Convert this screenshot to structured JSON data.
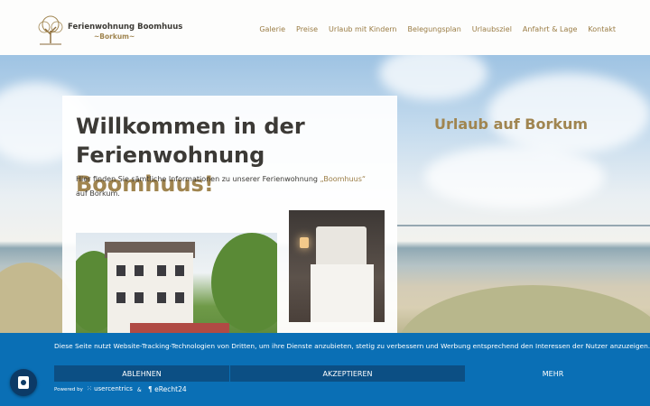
{
  "header": {
    "logo_title": "Ferienwohnung Boomhuus",
    "logo_sub": "~Borkum~",
    "nav": [
      "Galerie",
      "Preise",
      "Urlaub mit Kindern",
      "Belegungsplan",
      "Urlaubsziel",
      "Anfahrt & Lage",
      "Kontakt"
    ]
  },
  "hero": {
    "title_line1": "Willkommen in der",
    "title_line2_plain": "Ferienwohnung ",
    "title_line2_accent": "Boomhuus!",
    "text_plain": "Hier finden Sie sämtliche Informationen zu unserer Ferienwohnung ",
    "text_accent": "„Boomhuus“",
    "text_end": " auf Borkum.",
    "side_heading": "Urlaub auf Borkum"
  },
  "cookie": {
    "text": "Diese Seite nutzt Website-Tracking-Technologien von Dritten, um ihre Dienste anzubieten, stetig zu verbessern und Werbung entsprechend den Interessen der Nutzer anzuzeigen.",
    "decline": "ABLEHNEN",
    "accept": "AKZEPTIEREN",
    "more": "MEHR",
    "powered_by": "Powered by",
    "brand1": "usercentrics",
    "amp": "&",
    "brand2": "eRecht24"
  },
  "colors": {
    "accent": "#a08550",
    "banner": "#0a6fb5",
    "button_dark": "#0c4f84"
  }
}
